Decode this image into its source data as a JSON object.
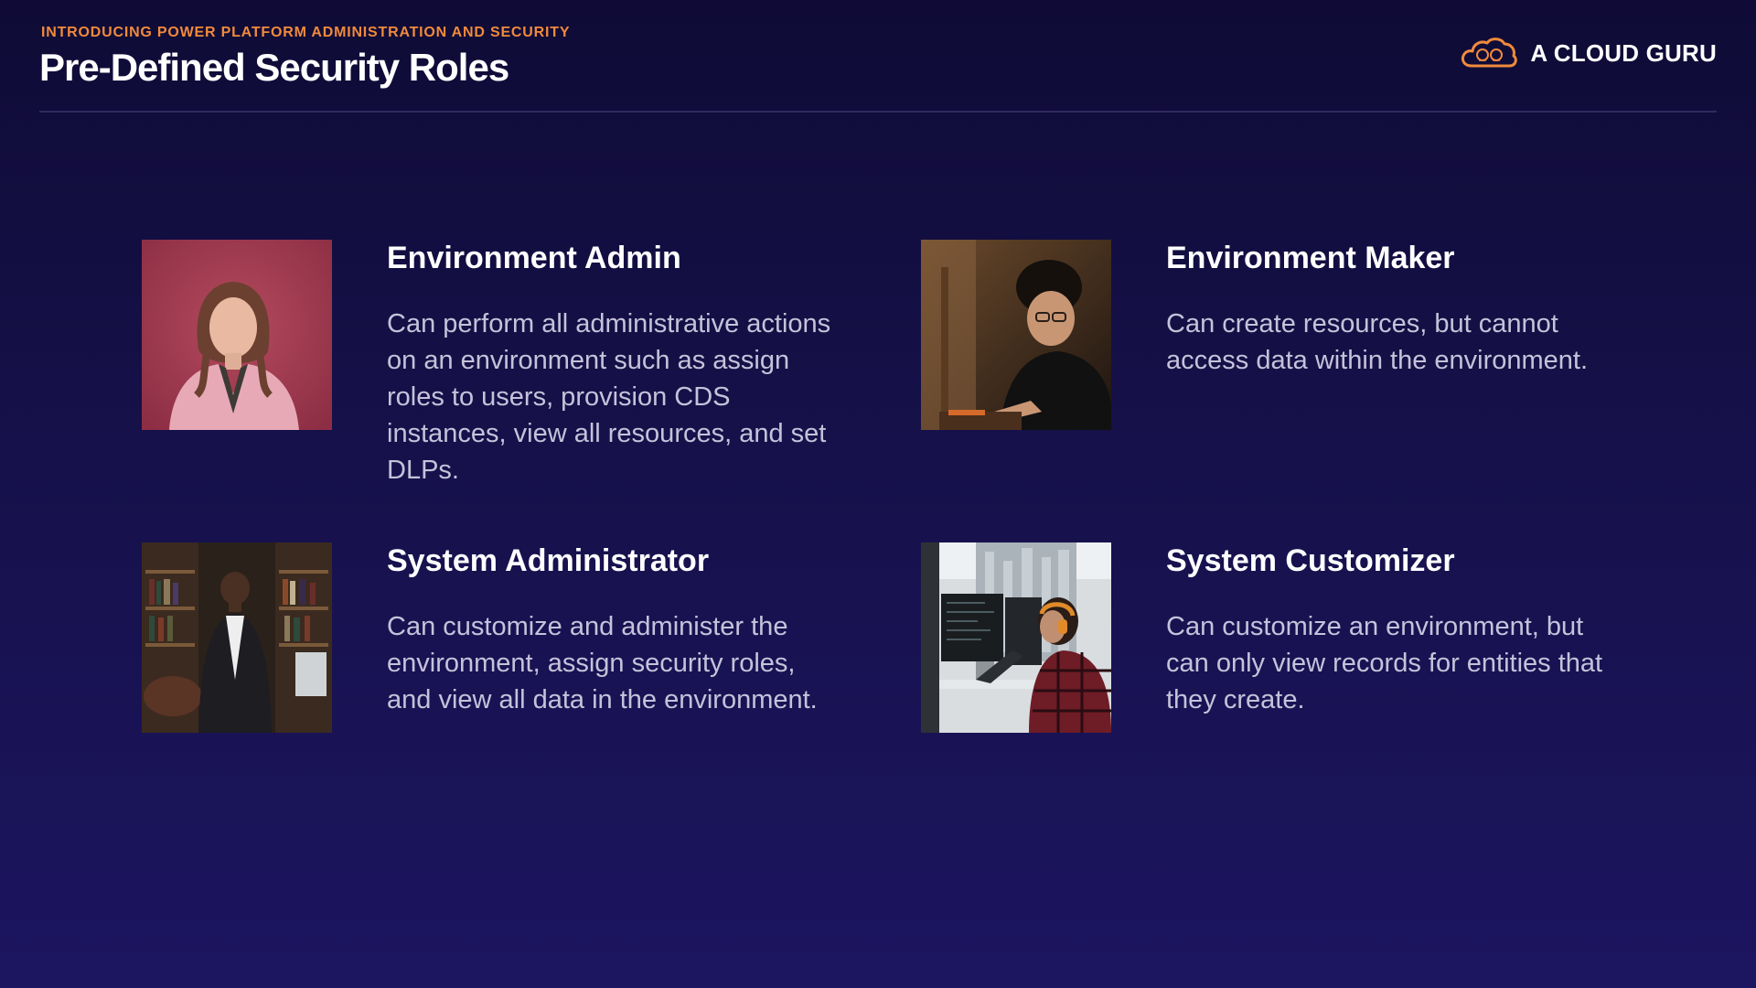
{
  "header": {
    "eyebrow": "INTRODUCING POWER PLATFORM ADMINISTRATION AND SECURITY",
    "title": "Pre-Defined Security Roles"
  },
  "brand": {
    "name": "A CLOUD GURU",
    "logo_icon": "cloud-logo-icon",
    "accent_color": "#f08a3c"
  },
  "roles": [
    {
      "title": "Environment Admin",
      "description": "Can perform all administrative actions on an environment such as assign roles to users, provision CDS instances, view all resources, and set DLPs.",
      "photo": "portrait-woman-pink-blazer"
    },
    {
      "title": "Environment Maker",
      "description": "Can create resources, but cannot access data within the environment.",
      "photo": "man-working-at-desk"
    },
    {
      "title": "System Administrator",
      "description": "Can customize and administer the environment, assign security roles, and view all data in the environment.",
      "photo": "woman-in-suit-library"
    },
    {
      "title": "System Customizer",
      "description": "Can customize an environment, but can only view records for entities that they create.",
      "photo": "woman-with-headphones-at-monitors"
    }
  ],
  "colors": {
    "background_top": "#0f0b36",
    "background_bottom": "#1c1560",
    "description_text": "#c5c2da"
  }
}
